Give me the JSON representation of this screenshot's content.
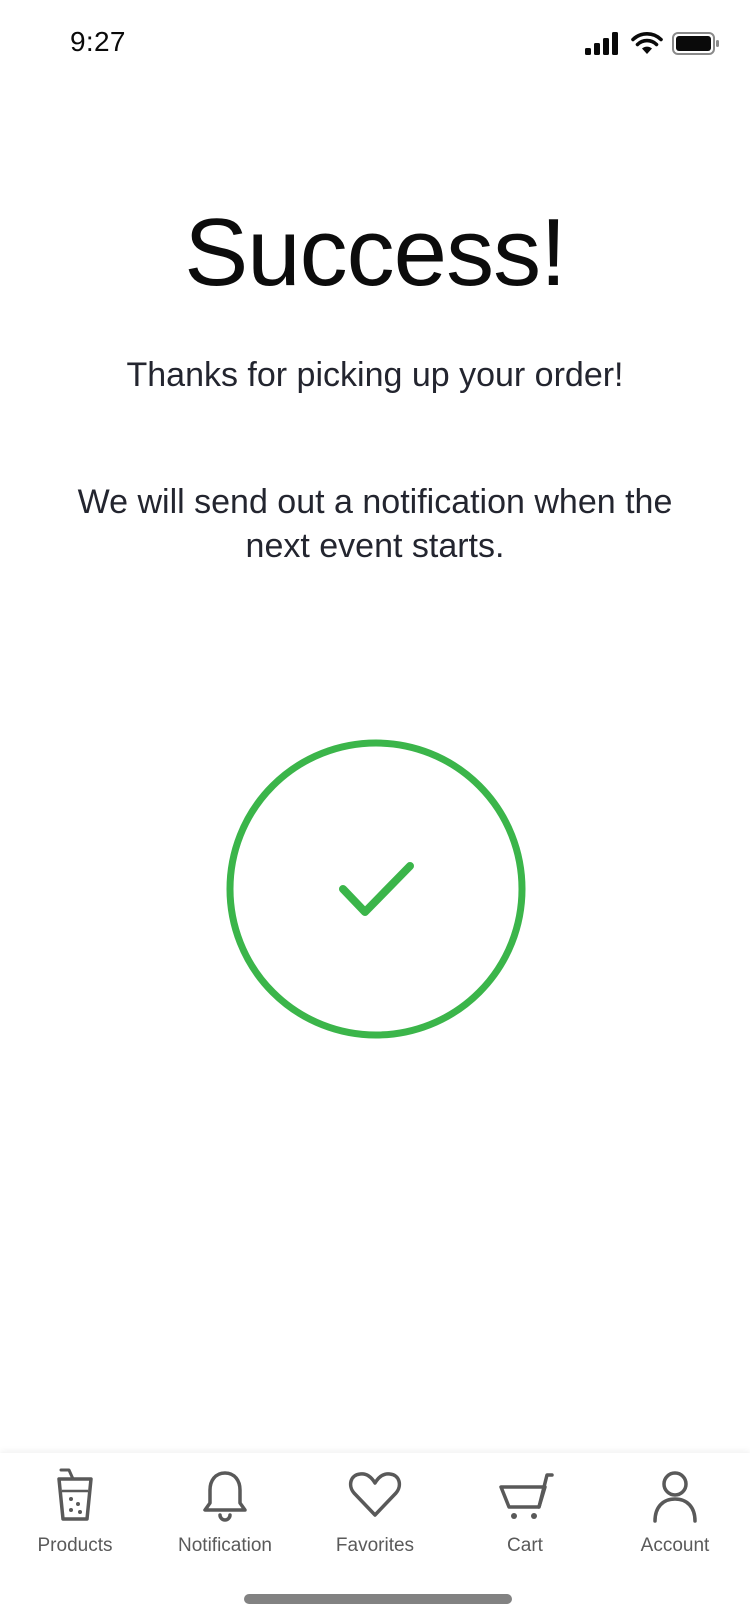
{
  "status_bar": {
    "time": "9:27",
    "icons": [
      "cellular-signal-icon",
      "wifi-icon",
      "battery-icon"
    ]
  },
  "main": {
    "title": "Success!",
    "subtitle": "Thanks for picking up your order!",
    "message": "We will send out a notification when the next event starts.",
    "success_icon": "checkmark-circle-icon",
    "accent_color": "#3bb54a"
  },
  "tab_bar": {
    "items": [
      {
        "label": "Products",
        "icon": "drink-cup-icon"
      },
      {
        "label": "Notification",
        "icon": "bell-icon"
      },
      {
        "label": "Favorites",
        "icon": "heart-icon"
      },
      {
        "label": "Cart",
        "icon": "cart-icon"
      },
      {
        "label": "Account",
        "icon": "user-icon"
      }
    ],
    "icon_color": "#595959"
  }
}
